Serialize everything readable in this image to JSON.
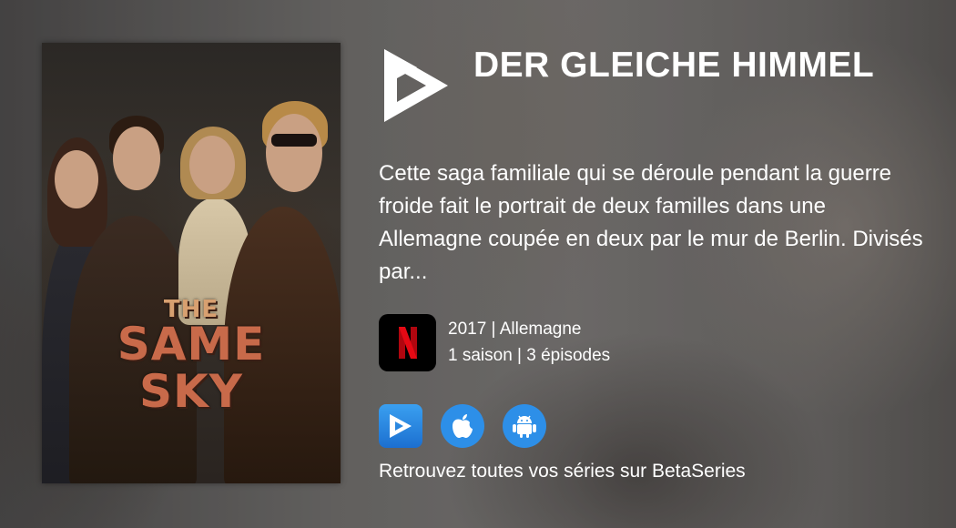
{
  "show": {
    "title": "DER GLEICHE HIMMEL",
    "synopsis": "Cette saga familiale qui se déroule pendant la guerre froide fait le portrait de deux familles dans une Allemagne coupée en deux par le mur de Berlin. Divisés par...",
    "year_country": "2017 | Allemagne",
    "seasons_episodes": "1 saison | 3 épisodes"
  },
  "poster": {
    "title_small": "THE",
    "title_line1": "SAME",
    "title_line2": "SKY"
  },
  "provider": {
    "name": "Netflix",
    "letter": "N",
    "color": "#e50914"
  },
  "apps": [
    {
      "icon": "betaseries-icon"
    },
    {
      "icon": "apple-icon"
    },
    {
      "icon": "android-icon"
    }
  ],
  "footer": {
    "tagline": "Retrouvez toutes vos séries sur BetaSeries"
  },
  "colors": {
    "accent": "#2d8fe8",
    "text": "#ffffff"
  }
}
